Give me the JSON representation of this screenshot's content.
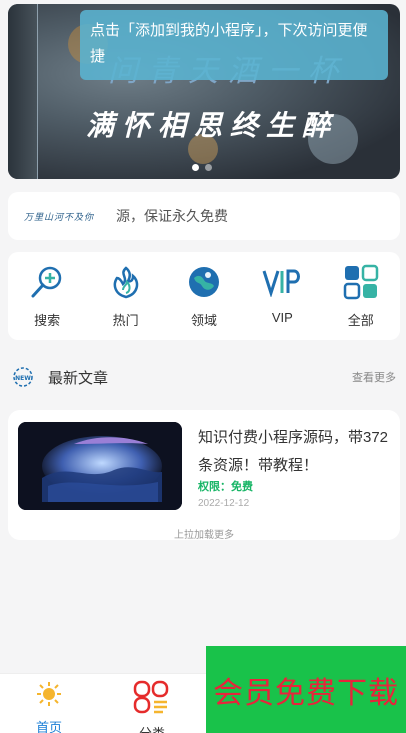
{
  "banner": {
    "line1": "问青天酒一杯",
    "line2": "满怀相思终生醉"
  },
  "tooltip": {
    "text": "点击「添加到我的小程序」，下次访问更便捷"
  },
  "notice": {
    "logo_text": "万里山河不及你",
    "text": "源，保证永久免费"
  },
  "menu": [
    {
      "label": "搜索",
      "icon": "search-plus-icon"
    },
    {
      "label": "热门",
      "icon": "flame-icon"
    },
    {
      "label": "领域",
      "icon": "globe-icon"
    },
    {
      "label": "VIP",
      "icon": "vip-icon"
    },
    {
      "label": "全部",
      "icon": "grid-icon"
    }
  ],
  "section": {
    "title": "最新文章",
    "more": "查看更多",
    "badge": "NEW"
  },
  "article": {
    "title": "知识付费小程序源码，带372条资源！带教程！",
    "permission": "权限：免费",
    "date": "2022-12-12",
    "load_more": "上拉加载更多"
  },
  "tabs": [
    {
      "label": "首页",
      "icon": "sun-icon",
      "active": true
    },
    {
      "label": "分类",
      "icon": "category-icon",
      "active": false
    }
  ],
  "promo": {
    "text": "会员免费下载"
  },
  "colors": {
    "accent": "#1c7fd6",
    "green": "#19c24a",
    "promo_text": "#e8243b",
    "free": "#18b566"
  }
}
